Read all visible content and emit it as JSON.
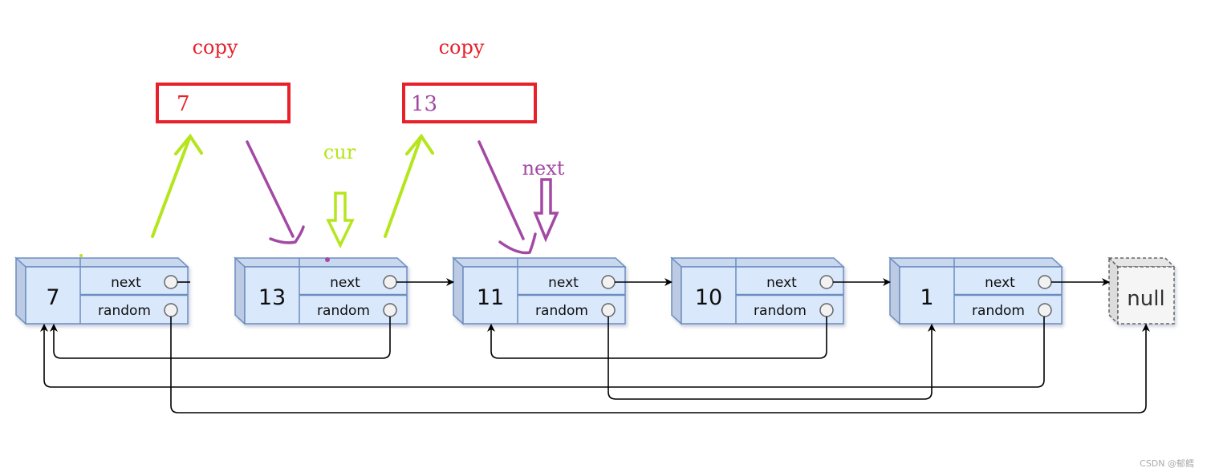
{
  "colors": {
    "node_fill": "#dae8fc",
    "node_stroke": "#6c8ebf",
    "copy_red": "#e8202a",
    "green": "#b5e61d",
    "purple": "#a349a4",
    "null_fill": "#f5f5f5"
  },
  "nodes": [
    {
      "value": "7",
      "next_label": "next",
      "random_label": "random"
    },
    {
      "value": "13",
      "next_label": "next",
      "random_label": "random"
    },
    {
      "value": "11",
      "next_label": "next",
      "random_label": "random"
    },
    {
      "value": "10",
      "next_label": "next",
      "random_label": "random"
    },
    {
      "value": "1",
      "next_label": "next",
      "random_label": "random"
    }
  ],
  "null_label": "null",
  "copies": [
    {
      "label": "copy",
      "value": "7"
    },
    {
      "label": "copy",
      "value": "13"
    }
  ],
  "pointers": {
    "cur": "cur",
    "next": "next"
  },
  "watermark": "CSDN @郁鳕"
}
